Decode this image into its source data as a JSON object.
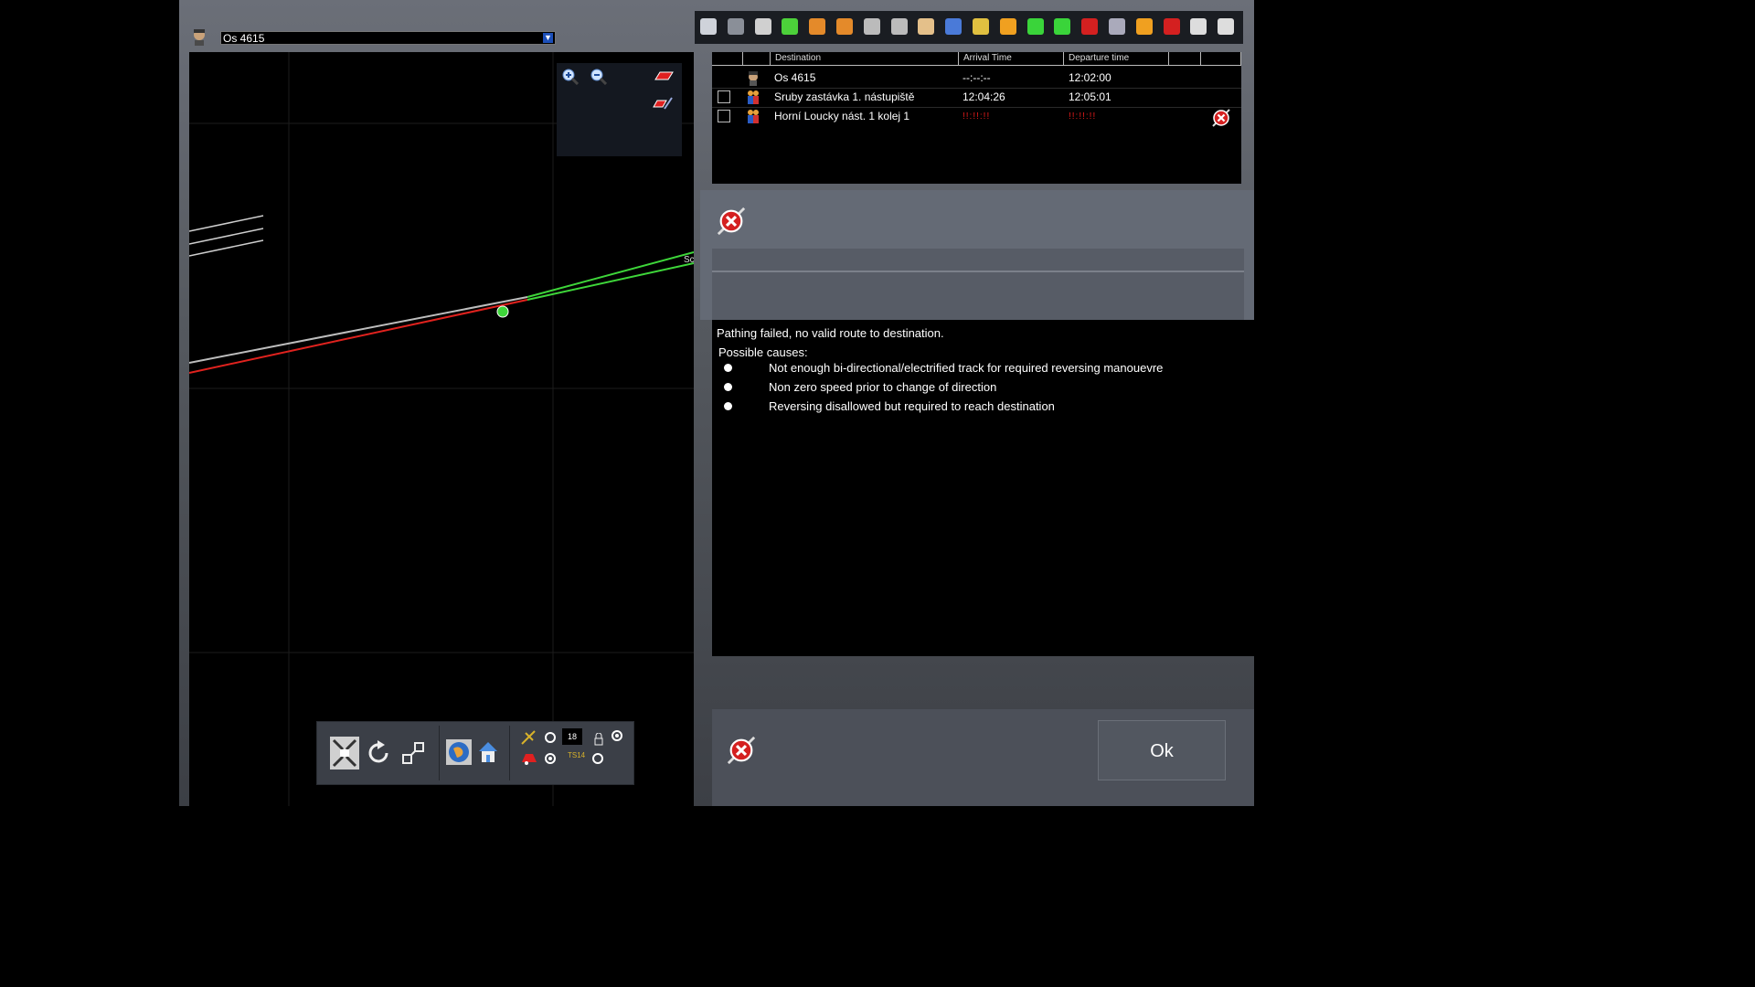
{
  "train_selector": {
    "value": "Os 4615"
  },
  "toolbar": {
    "icons": [
      "save-icon",
      "delete-icon",
      "grid-small-icon",
      "grid-large-icon",
      "move-up-icon",
      "move-down-icon",
      "split-icon",
      "join-icon",
      "hand-icon",
      "passengers-icon",
      "edit-icon",
      "orange-grid-icon",
      "add-green-icon",
      "add-plus-icon",
      "cancel-path-icon",
      "settings-icon",
      "forward-icon",
      "flag-icon",
      "monitor-icon",
      "platform-icon"
    ]
  },
  "timetable": {
    "columns": {
      "destination": "Destination",
      "arrival": "Arrival Time",
      "departure": "Departure time"
    },
    "rows": [
      {
        "destination": "Os 4615",
        "arrival": "--:--:--",
        "departure": "12:02:00",
        "icon": "driver-icon"
      },
      {
        "destination": "Sruby zastávka  1. nástupiště",
        "arrival": "12:04:26",
        "departure": "12:05:01",
        "icon": "passengers-icon"
      },
      {
        "destination": "Horní Loucky nást. 1 kolej 1",
        "arrival": "!!:!!:!!",
        "departure": "!!:!!:!!",
        "icon": "passengers-icon"
      }
    ]
  },
  "map": {
    "marker_label": "Sc"
  },
  "bottom_toolbar": {
    "number_display": "18",
    "small_label": "TS14"
  },
  "message": {
    "title": "Pathing failed, no valid route to destination.",
    "causes_header": "Possible causes:",
    "causes": [
      "Not enough bi-directional/electrified track for required reversing manouevre",
      "Non zero speed prior to change of direction",
      "Reversing disallowed but required to reach destination"
    ]
  },
  "ok_label": "Ok",
  "colors": {
    "path_red": "#e0221e",
    "path_green": "#3ed63a",
    "error_red": "#e21a1a"
  }
}
